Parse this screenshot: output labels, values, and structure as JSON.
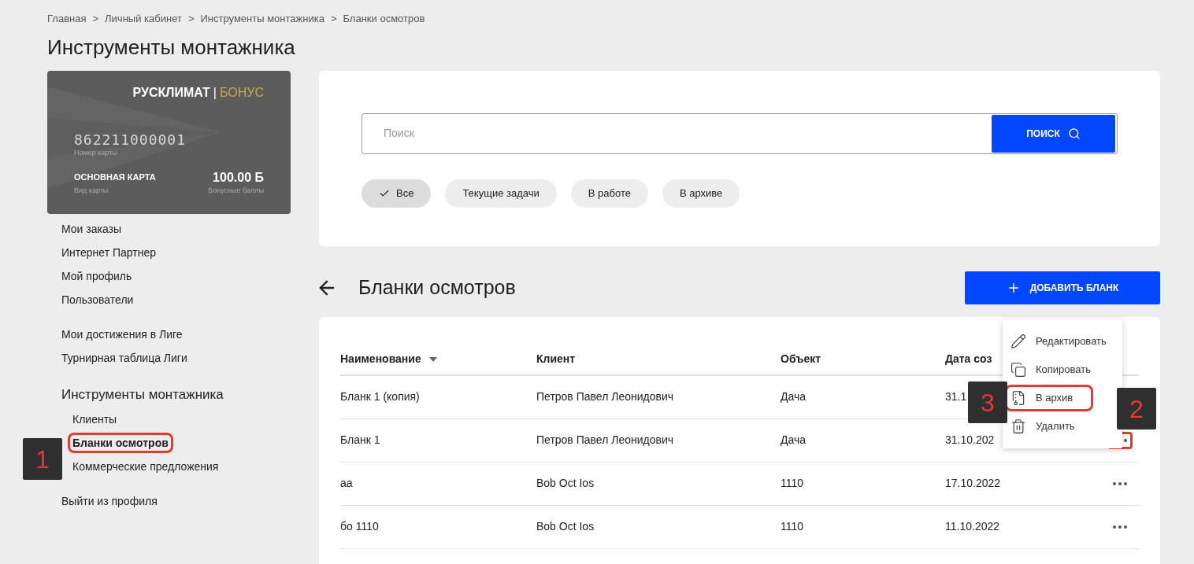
{
  "breadcrumbs": [
    "Главная",
    "Личный кабинет",
    "Инструменты монтажника",
    "Бланки осмотров"
  ],
  "breadcrumb_separator": ">",
  "page_title": "Инструменты монтажника",
  "bonus_card": {
    "brand": "РУСКЛИМАТ",
    "brand_separator": "|",
    "brand_accent": "БОНУС",
    "number": "862211000001",
    "number_label": "Номер карты",
    "type": "ОСНОВНАЯ КАРТА",
    "type_label": "Вид карты",
    "balance": "100.00 Б",
    "balance_label": "Бонусные баллы"
  },
  "sidebar": {
    "groups": [
      {
        "items": [
          {
            "label": "Мои заказы",
            "selected": false,
            "highlighted": false
          },
          {
            "label": "Интернет Партнер",
            "selected": false,
            "highlighted": false
          },
          {
            "label": "Мой профиль",
            "selected": false,
            "highlighted": false
          },
          {
            "label": "Пользователи",
            "selected": false,
            "highlighted": false
          }
        ]
      },
      {
        "items": [
          {
            "label": "Мои достижения в Лиге",
            "selected": false,
            "highlighted": false
          },
          {
            "label": "Турнирная таблица Лиги",
            "selected": false,
            "highlighted": false
          }
        ]
      },
      {
        "heading": "Инструменты монтажника",
        "items": [
          {
            "label": "Клиенты",
            "selected": false,
            "highlighted": false
          },
          {
            "label": "Бланки осмотров",
            "selected": true,
            "highlighted": true
          },
          {
            "label": "Коммерческие предложения",
            "selected": false,
            "highlighted": false
          }
        ]
      },
      {
        "items": [
          {
            "label": "Выйти из профиля",
            "selected": false,
            "highlighted": false
          }
        ]
      }
    ]
  },
  "search": {
    "placeholder": "Поиск",
    "button": "ПОИСК"
  },
  "filters": [
    {
      "label": "Все",
      "selected": true
    },
    {
      "label": "Текущие задачи",
      "selected": false
    },
    {
      "label": "В работе",
      "selected": false
    },
    {
      "label": "В архиве",
      "selected": false
    }
  ],
  "section_title": "Бланки осмотров",
  "add_button": "ДОБАВИТЬ БЛАНК",
  "table": {
    "columns": [
      {
        "label": "Наименование",
        "sorted": true
      },
      {
        "label": "Клиент",
        "sorted": false
      },
      {
        "label": "Объект",
        "sorted": false
      },
      {
        "label": "Дата соз",
        "sorted": false
      }
    ],
    "rows": [
      {
        "cells": [
          "Бланк 1 (копия)",
          "Петров Павел Леонидович",
          "Дача",
          "31.1"
        ],
        "menu_open": false
      },
      {
        "cells": [
          "Бланк 1",
          "Петров Павел Леонидович",
          "Дача",
          "31.10.202"
        ],
        "menu_open": true
      },
      {
        "cells": [
          "аа",
          "Bob Oct Ios",
          "1110",
          "17.10.2022"
        ],
        "menu_open": false
      },
      {
        "cells": [
          "бо 1110",
          "Bob Oct Ios",
          "1110",
          "11.10.2022"
        ],
        "menu_open": false
      }
    ]
  },
  "context_menu": {
    "items": [
      {
        "kind": "edit",
        "label": "Редактировать",
        "highlighted": false
      },
      {
        "kind": "copy",
        "label": "Копировать",
        "highlighted": false
      },
      {
        "kind": "archive",
        "label": "В архив",
        "highlighted": true
      },
      {
        "kind": "delete",
        "label": "Удалить",
        "highlighted": false
      }
    ]
  },
  "callouts": [
    {
      "number": "1"
    },
    {
      "number": "2"
    },
    {
      "number": "3"
    }
  ]
}
